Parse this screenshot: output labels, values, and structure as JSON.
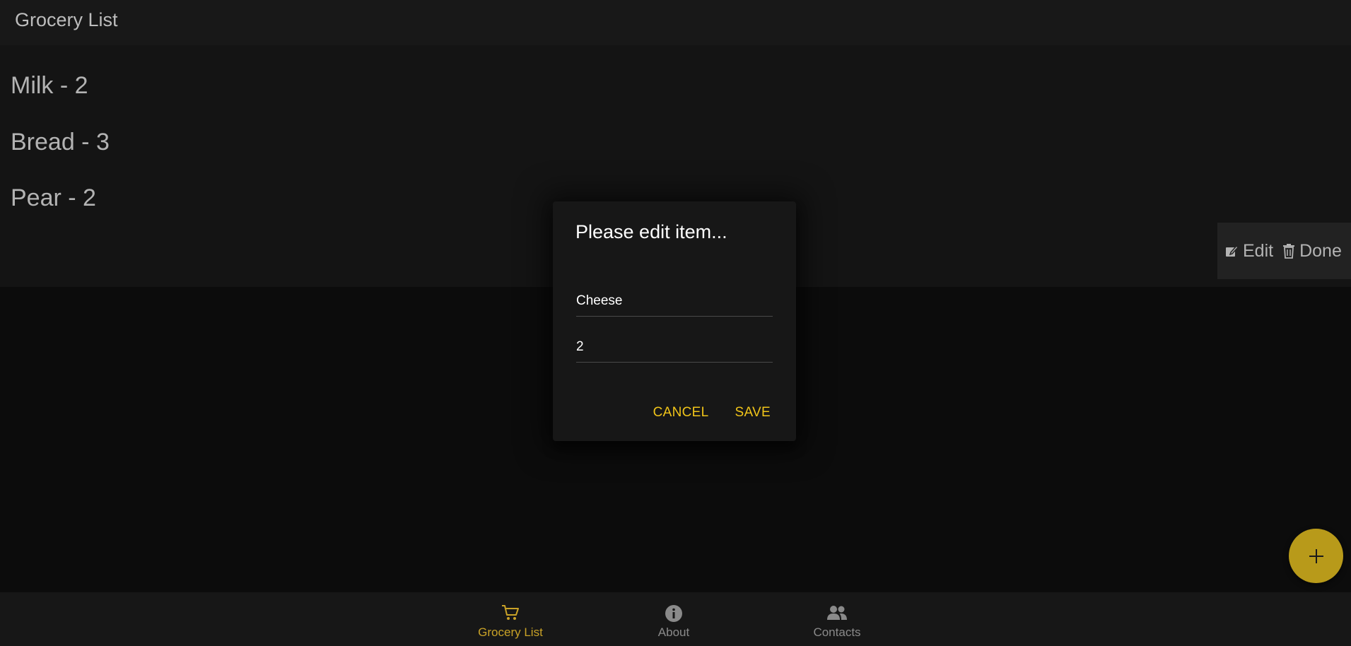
{
  "header": {
    "title": "Grocery List"
  },
  "list": {
    "items": [
      {
        "label": "Milk - 2"
      },
      {
        "label": "Bread - 3"
      },
      {
        "label": "Pear - 2"
      }
    ]
  },
  "swipe_actions": {
    "edit_label": "Edit",
    "edit_icon": "edit-icon",
    "done_label": "Done",
    "done_icon": "trash-icon"
  },
  "dialog": {
    "title": "Please edit item...",
    "name_value": "Cheese",
    "quantity_value": "2",
    "cancel_label": "CANCEL",
    "save_label": "SAVE"
  },
  "fab": {
    "icon": "plus-icon"
  },
  "bottom_nav": {
    "items": [
      {
        "label": "Grocery List",
        "icon": "cart-icon",
        "active": true
      },
      {
        "label": "About",
        "icon": "info-icon",
        "active": false
      },
      {
        "label": "Contacts",
        "icon": "people-icon",
        "active": false
      }
    ]
  },
  "colors": {
    "accent": "#f0c419",
    "fab": "#b89a1a",
    "nav_active": "#c9a227",
    "background": "#0c0c0c"
  }
}
